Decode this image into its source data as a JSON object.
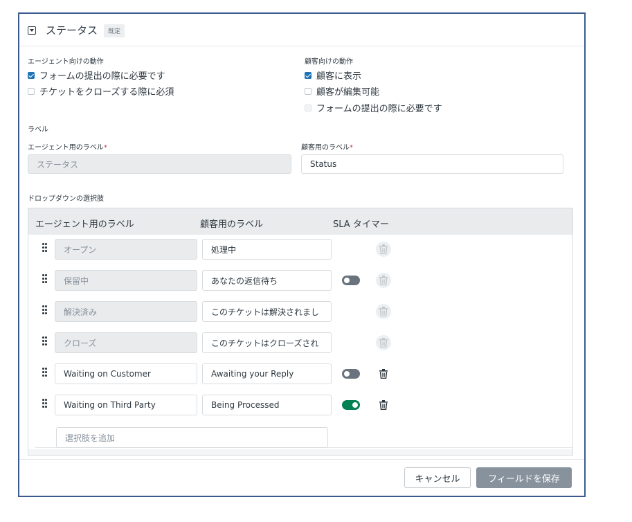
{
  "header": {
    "title": "ステータス",
    "badge": "既定",
    "icon": "dropdown-field-icon"
  },
  "agent_behavior": {
    "title": "エージェント向けの動作",
    "options": [
      {
        "label": "フォームの提出の際に必要です",
        "checked": true,
        "disabled": false
      },
      {
        "label": "チケットをクローズする際に必須",
        "checked": false,
        "disabled": false
      }
    ]
  },
  "customer_behavior": {
    "title": "顧客向けの動作",
    "options": [
      {
        "label": "顧客に表示",
        "checked": true,
        "disabled": false
      },
      {
        "label": "顧客が編集可能",
        "checked": false,
        "disabled": false
      },
      {
        "label": "フォームの提出の際に必要です",
        "checked": false,
        "disabled": true
      }
    ]
  },
  "labels_section": {
    "title": "ラベル",
    "agent_label": {
      "label": "エージェント用のラベル",
      "required_mark": "*",
      "value": "ステータス"
    },
    "customer_label": {
      "label": "顧客用のラベル",
      "required_mark": "*",
      "value": "Status"
    }
  },
  "dropdown": {
    "title": "ドロップダウンの選択肢",
    "columns": [
      "エージェント用のラベル",
      "顧客用のラベル",
      "SLA タイマー"
    ],
    "rows": [
      {
        "agent": "オープン",
        "customer": "処理中",
        "agent_disabled": true,
        "sla": null,
        "trash_disabled": true
      },
      {
        "agent": "保留中",
        "customer": "あなたの返信待ち",
        "agent_disabled": true,
        "sla": "off",
        "trash_disabled": true
      },
      {
        "agent": "解決済み",
        "customer": "このチケットは解決されまし",
        "agent_disabled": true,
        "sla": null,
        "trash_disabled": true
      },
      {
        "agent": "クローズ",
        "customer": "このチケットはクローズされ",
        "agent_disabled": true,
        "sla": null,
        "trash_disabled": true
      },
      {
        "agent": "Waiting on Customer",
        "customer": "Awaiting your Reply",
        "agent_disabled": false,
        "sla": "off",
        "trash_disabled": false
      },
      {
        "agent": "Waiting on Third Party",
        "customer": "Being Processed",
        "agent_disabled": false,
        "sla": "on",
        "trash_disabled": false
      }
    ],
    "add_placeholder": "選択肢を追加"
  },
  "footer": {
    "cancel_label": "キャンセル",
    "save_label": "フィールドを保存"
  },
  "colors": {
    "accent": "#1f73b7",
    "toggle_on": "#038153",
    "toggle_off": "#68737d",
    "save_disabled": "#87929d"
  }
}
